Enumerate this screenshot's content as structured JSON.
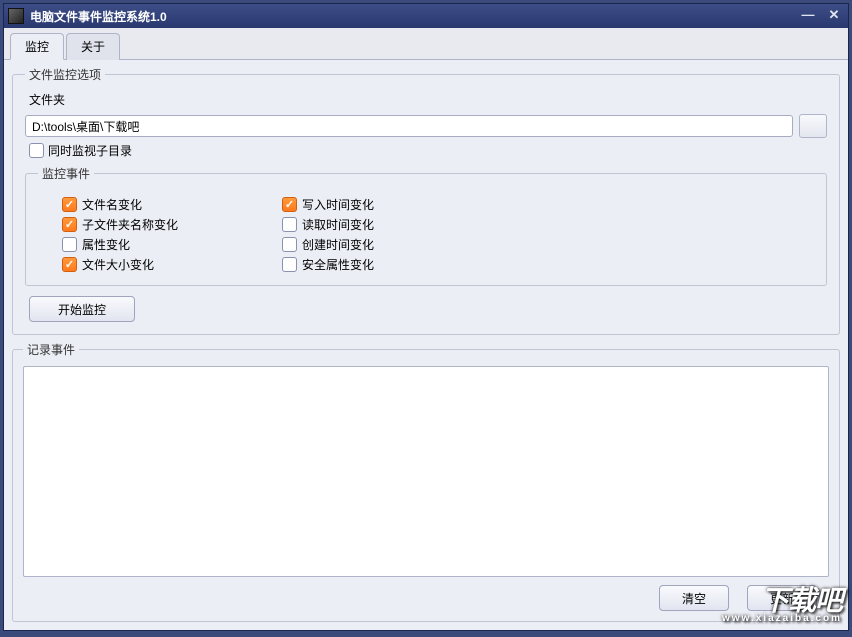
{
  "window": {
    "title": "电脑文件事件监控系统1.0"
  },
  "tabs": {
    "monitor": "监控",
    "about": "关于"
  },
  "options": {
    "legend": "文件监控选项",
    "folder_label": "文件夹",
    "folder_value": "D:\\tools\\桌面\\下载吧",
    "watch_subdirs": "同时监视子目录"
  },
  "events": {
    "legend": "监控事件",
    "filename_change": "文件名变化",
    "subfolder_name_change": "子文件夹名称变化",
    "attr_change": "属性变化",
    "size_change": "文件大小变化",
    "write_time_change": "写入时间变化",
    "read_time_change": "读取时间变化",
    "create_time_change": "创建时间变化",
    "security_attr_change": "安全属性变化"
  },
  "buttons": {
    "start": "开始监控",
    "clear": "清空",
    "refresh": "更新"
  },
  "log": {
    "legend": "记录事件"
  },
  "watermark": {
    "text": "下载吧",
    "url": "www.xiazaiba.com"
  }
}
